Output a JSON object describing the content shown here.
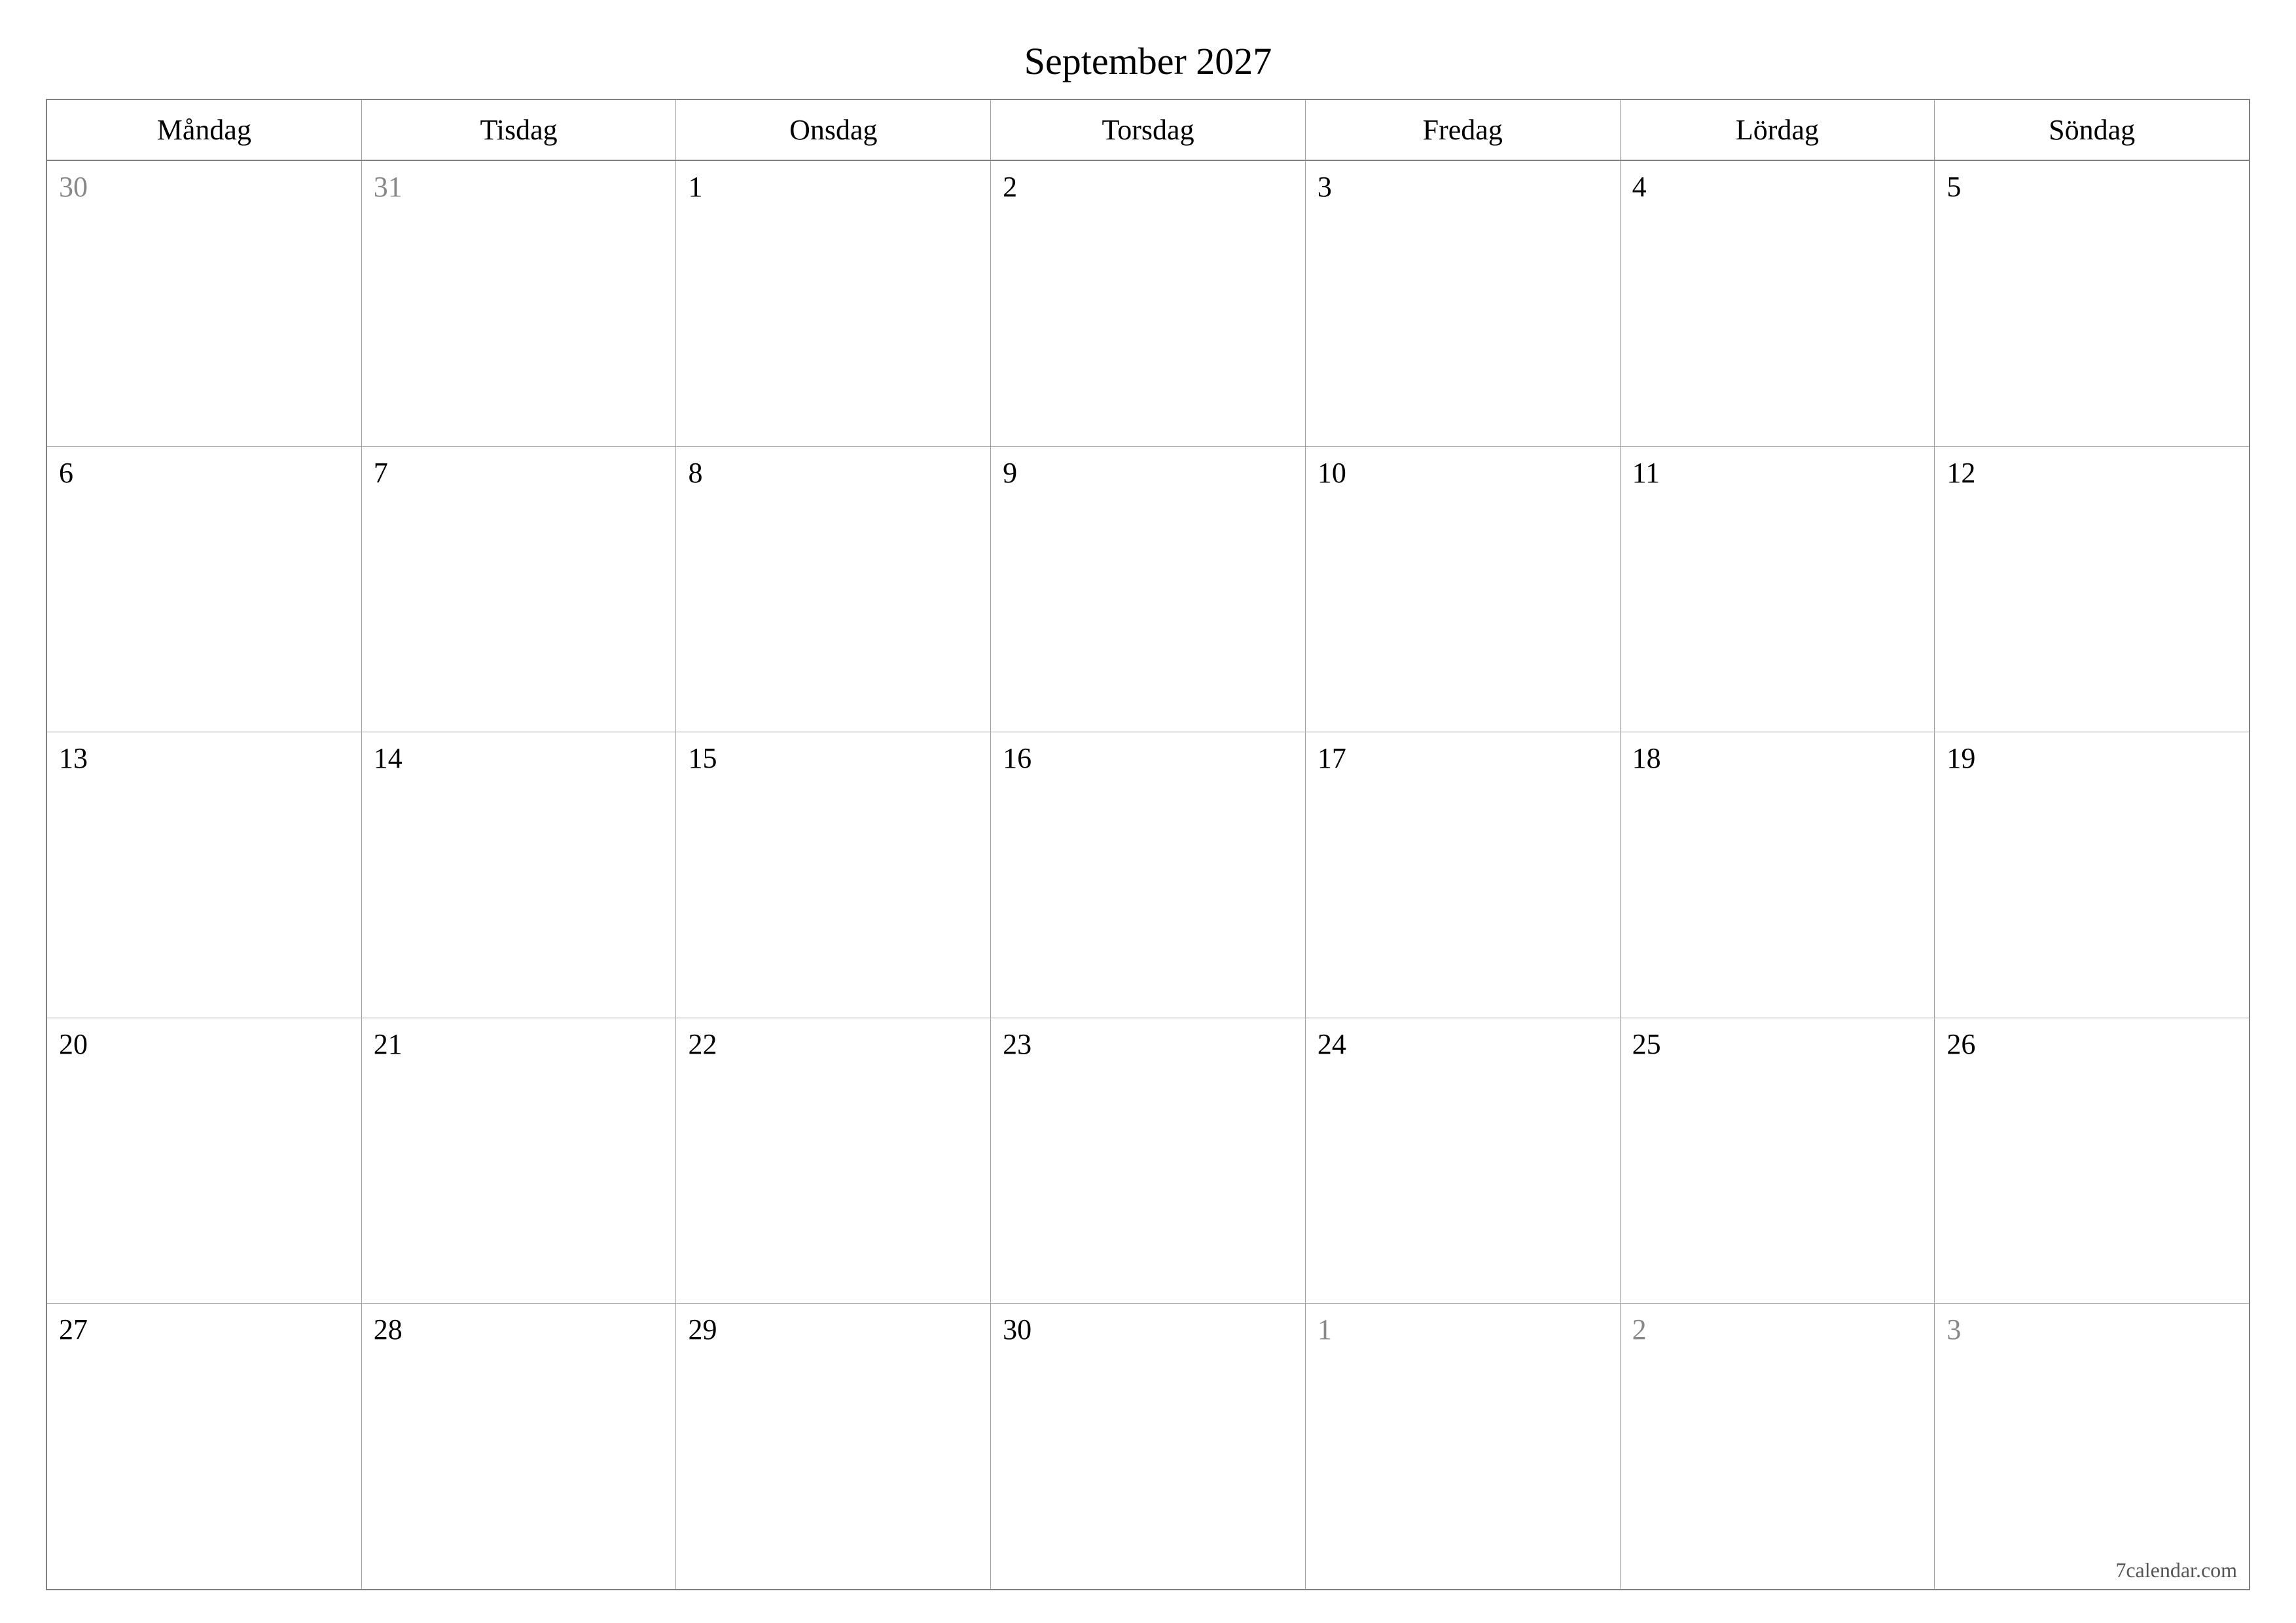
{
  "title": "September 2027",
  "weekdays": [
    "Måndag",
    "Tisdag",
    "Onsdag",
    "Torsdag",
    "Fredag",
    "Lördag",
    "Söndag"
  ],
  "weeks": [
    [
      {
        "day": "30",
        "otherMonth": true
      },
      {
        "day": "31",
        "otherMonth": true
      },
      {
        "day": "1",
        "otherMonth": false
      },
      {
        "day": "2",
        "otherMonth": false
      },
      {
        "day": "3",
        "otherMonth": false
      },
      {
        "day": "4",
        "otherMonth": false
      },
      {
        "day": "5",
        "otherMonth": false
      }
    ],
    [
      {
        "day": "6",
        "otherMonth": false
      },
      {
        "day": "7",
        "otherMonth": false
      },
      {
        "day": "8",
        "otherMonth": false
      },
      {
        "day": "9",
        "otherMonth": false
      },
      {
        "day": "10",
        "otherMonth": false
      },
      {
        "day": "11",
        "otherMonth": false
      },
      {
        "day": "12",
        "otherMonth": false
      }
    ],
    [
      {
        "day": "13",
        "otherMonth": false
      },
      {
        "day": "14",
        "otherMonth": false
      },
      {
        "day": "15",
        "otherMonth": false
      },
      {
        "day": "16",
        "otherMonth": false
      },
      {
        "day": "17",
        "otherMonth": false
      },
      {
        "day": "18",
        "otherMonth": false
      },
      {
        "day": "19",
        "otherMonth": false
      }
    ],
    [
      {
        "day": "20",
        "otherMonth": false
      },
      {
        "day": "21",
        "otherMonth": false
      },
      {
        "day": "22",
        "otherMonth": false
      },
      {
        "day": "23",
        "otherMonth": false
      },
      {
        "day": "24",
        "otherMonth": false
      },
      {
        "day": "25",
        "otherMonth": false
      },
      {
        "day": "26",
        "otherMonth": false
      }
    ],
    [
      {
        "day": "27",
        "otherMonth": false
      },
      {
        "day": "28",
        "otherMonth": false
      },
      {
        "day": "29",
        "otherMonth": false
      },
      {
        "day": "30",
        "otherMonth": false
      },
      {
        "day": "1",
        "otherMonth": true
      },
      {
        "day": "2",
        "otherMonth": true
      },
      {
        "day": "3",
        "otherMonth": true
      }
    ]
  ],
  "footer": "7calendar.com"
}
